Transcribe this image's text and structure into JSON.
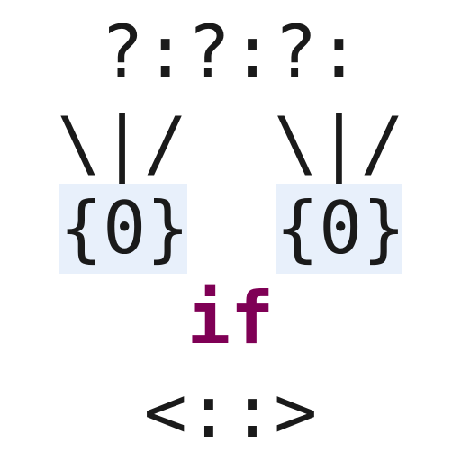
{
  "art": {
    "row1": "?:?:?:",
    "row2": "\\|/  \\|/",
    "row3_left": "{0}",
    "row3_right": "{0}",
    "row4_keyword": "if",
    "row5": "<::>"
  },
  "colors": {
    "keyword": "#7f0055",
    "block_highlight": "#e8f0fb",
    "text": "#1a1a1a"
  }
}
